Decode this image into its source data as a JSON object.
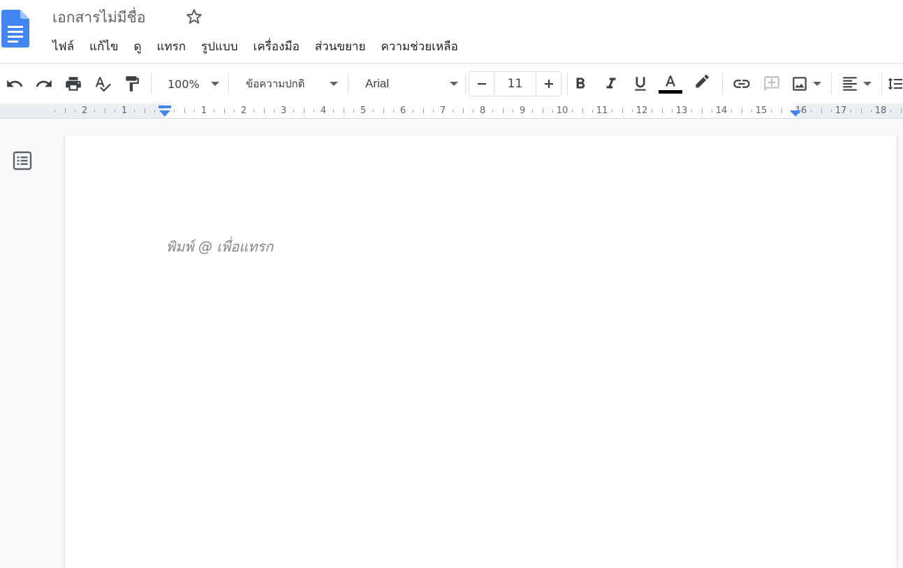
{
  "app": {
    "doc_title": "เอกสารไม่มีชื่อ",
    "logo_icon": "google-docs-logo",
    "star_icon": "star-outline-icon"
  },
  "menu": [
    {
      "label": "ไฟล์"
    },
    {
      "label": "แก้ไข"
    },
    {
      "label": "ดู"
    },
    {
      "label": "แทรก"
    },
    {
      "label": "รูปแบบ"
    },
    {
      "label": "เครื่องมือ"
    },
    {
      "label": "ส่วนขยาย"
    },
    {
      "label": "ความช่วยเหลือ"
    }
  ],
  "toolbar": {
    "zoom": "100%",
    "style": "ข้อความปกติ",
    "font": "Arial",
    "font_size": "11",
    "text_color": "#000000",
    "icons": [
      "undo-icon",
      "redo-icon",
      "print-icon",
      "spellcheck-icon",
      "paint-format-icon",
      "bold-icon",
      "italic-icon",
      "underline-icon",
      "text-color-icon",
      "highlight-icon",
      "link-icon",
      "comment-icon",
      "image-icon",
      "align-icon",
      "line-spacing-icon"
    ]
  },
  "ruler": {
    "labels": [
      "2",
      "1",
      "1",
      "2",
      "3",
      "4",
      "5",
      "6",
      "7",
      "8",
      "9",
      "10",
      "11",
      "12",
      "13",
      "14",
      "15",
      "16",
      "17",
      "18"
    ],
    "marker_color": "#4285f4"
  },
  "document": {
    "placeholder": "พิมพ์ @ เพื่อแทรก"
  },
  "colors": {
    "accent": "#4285f4",
    "background": "#f8f9fa"
  }
}
